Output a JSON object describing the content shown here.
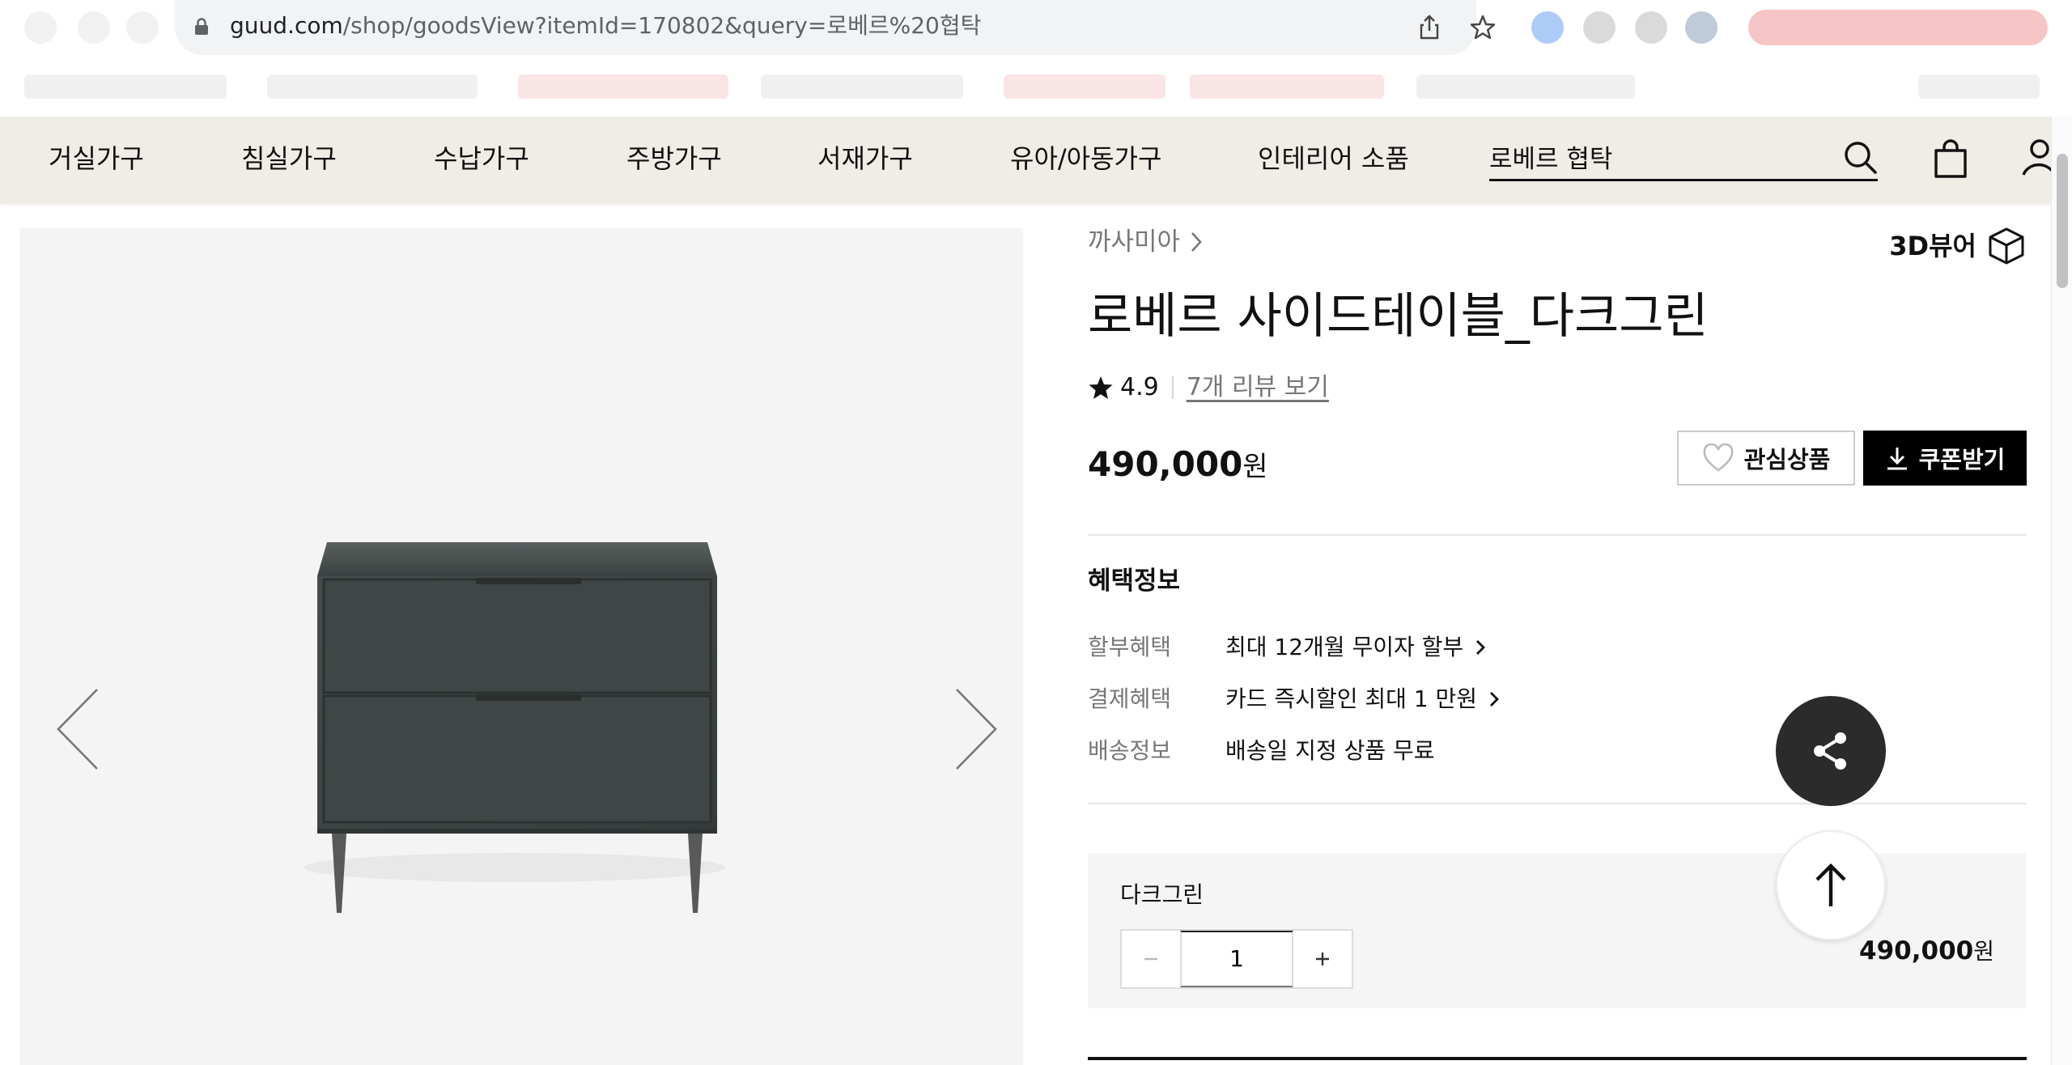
{
  "browser": {
    "url_host": "guud.com",
    "url_path": "/shop/goodsView?itemId=170802&query=로베르%20협탁"
  },
  "nav": {
    "categories": [
      "거실가구",
      "침실가구",
      "수납가구",
      "주방가구",
      "서재가구",
      "유아/아동가구",
      "인테리어 소품"
    ],
    "search_value": "로베르 협탁"
  },
  "product": {
    "brand": "까사미아",
    "viewer_label": "3D뷰어",
    "title": "로베르 사이드테이블_다크그린",
    "rating": "4.9",
    "reviews_link": "7개 리뷰 보기",
    "price": "490,000",
    "price_unit": "원",
    "wishlist_label": "관심상품",
    "coupon_label": "쿠폰받기"
  },
  "benefits": {
    "title": "혜택정보",
    "rows": [
      {
        "label": "할부혜택",
        "value": "최대 12개월 무이자 할부",
        "has_link": true
      },
      {
        "label": "결제혜택",
        "value": "카드 즉시할인 최대 1 만원",
        "has_link": true
      },
      {
        "label": "배송정보",
        "value": "배송일 지정 상품 무료",
        "has_link": false
      }
    ]
  },
  "option": {
    "name": "다크그린",
    "quantity": "1",
    "price": "490,000",
    "price_unit": "원"
  },
  "colors": {
    "nav_bg": "#f0ece6",
    "product_body": "#3f4645",
    "button_dark": "#000000",
    "fab_dark": "#2b2b2b"
  }
}
